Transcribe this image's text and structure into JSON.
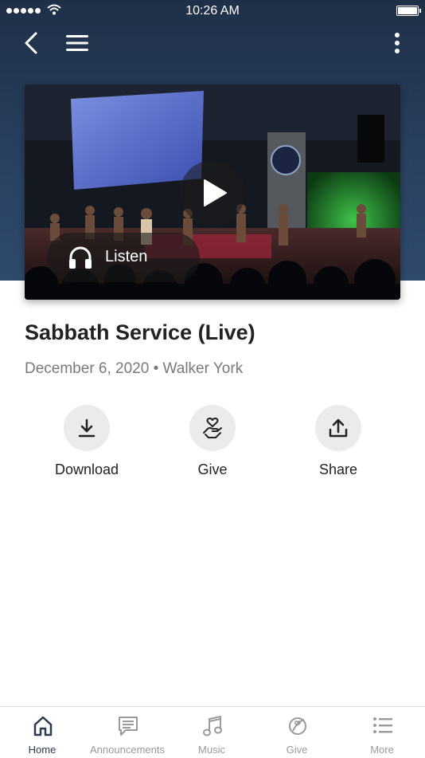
{
  "status_bar": {
    "time": "10:26 AM"
  },
  "header": {
    "back_icon": "chevron-left-icon",
    "menu_icon": "hamburger-icon",
    "more_icon": "more-vertical-icon"
  },
  "media": {
    "listen_label": "Listen",
    "play_icon": "play-icon",
    "listen_icon": "headphones-icon"
  },
  "sermon": {
    "title": "Sabbath Service (Live)",
    "meta": "December 6, 2020 • Walker York"
  },
  "actions": [
    {
      "label": "Download",
      "icon": "download-icon"
    },
    {
      "label": "Give",
      "icon": "give-heart-hand-icon"
    },
    {
      "label": "Share",
      "icon": "share-icon"
    }
  ],
  "tabs": [
    {
      "label": "Home",
      "icon": "home-icon",
      "active": true
    },
    {
      "label": "Announcements",
      "icon": "announcements-icon",
      "active": false
    },
    {
      "label": "Music",
      "icon": "music-icon",
      "active": false
    },
    {
      "label": "Give",
      "icon": "give-icon",
      "active": false
    },
    {
      "label": "More",
      "icon": "list-icon",
      "active": false
    }
  ],
  "colors": {
    "header_bg": "#2a4262",
    "active_tab": "#2b3a4e",
    "inactive_tab": "#9a9a9a",
    "action_circle": "#ebebeb"
  }
}
